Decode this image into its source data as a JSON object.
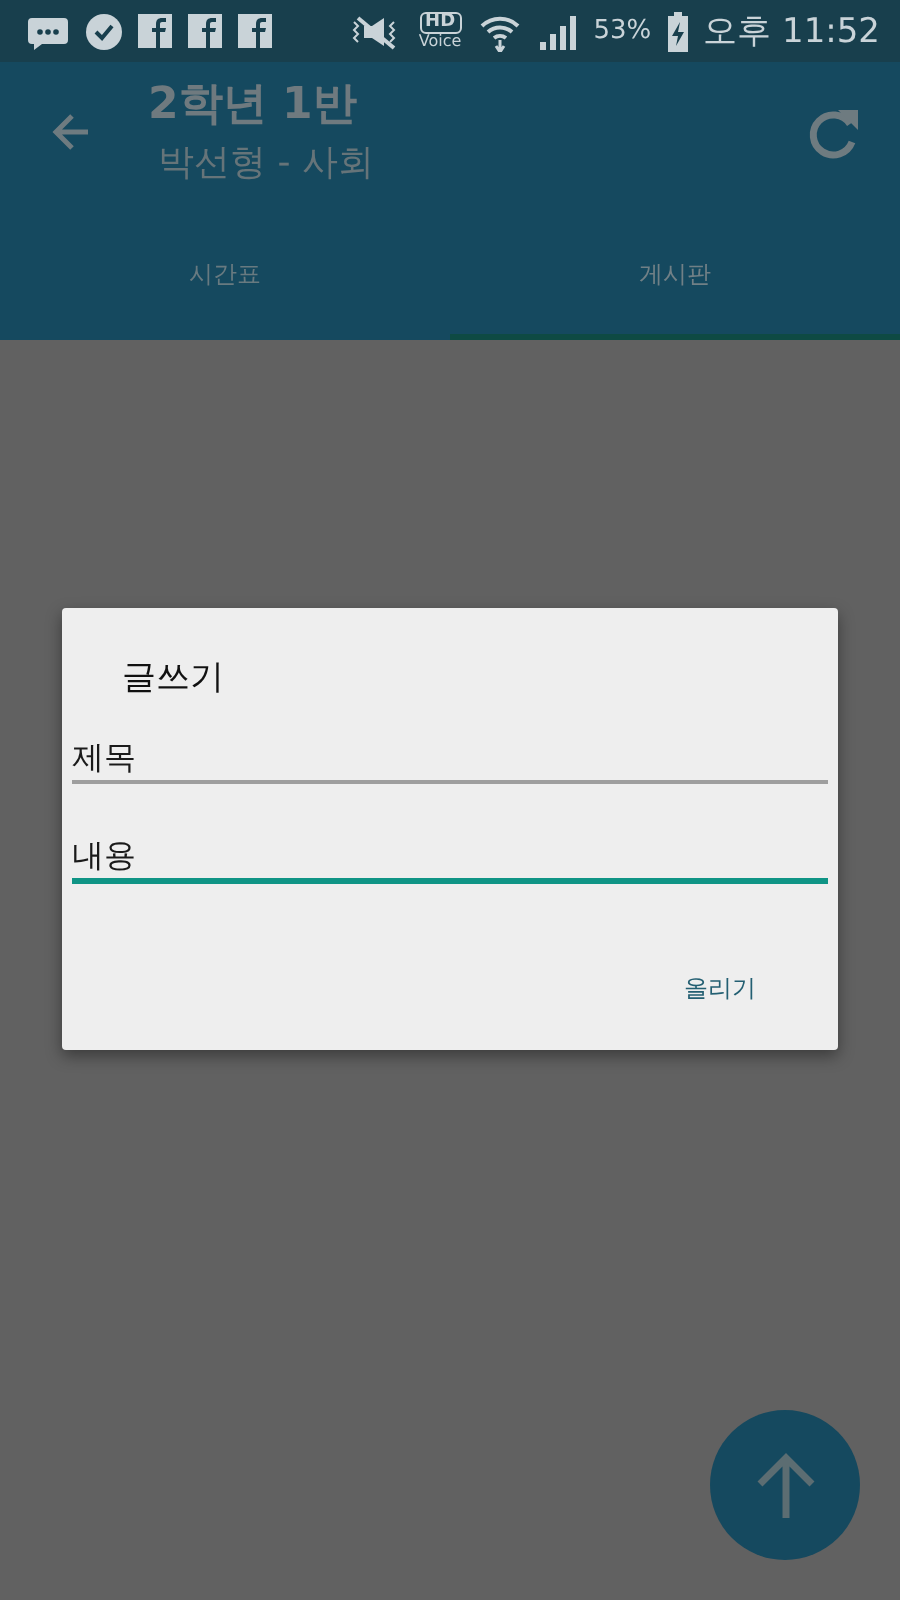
{
  "status_bar": {
    "hd_label": "HD",
    "voice_label": "Voice",
    "battery": "53%",
    "time": "오후 11:52"
  },
  "app_bar": {
    "title": "2학년 1반",
    "subtitle": "박선형 - 사회"
  },
  "tabs": [
    {
      "label": "시간표",
      "selected": false
    },
    {
      "label": "게시판",
      "selected": true
    }
  ],
  "dialog": {
    "title": "글쓰기",
    "fields": [
      {
        "placeholder": "제목",
        "focused": false
      },
      {
        "placeholder": "내용",
        "focused": true
      }
    ],
    "button": "올리기"
  }
}
